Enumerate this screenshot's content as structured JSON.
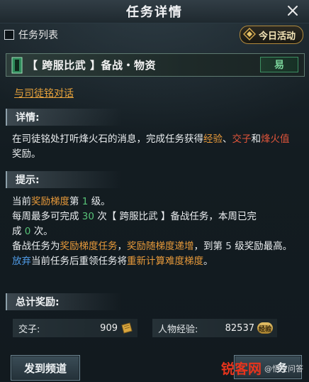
{
  "title": "任务详情",
  "task_list_label": "任务列表",
  "daily_button": "今日活动",
  "task": {
    "name": "【 跨服比武 】备战・物资",
    "difficulty": "易"
  },
  "npc_link": "与司徒铭对话",
  "details": {
    "heading": "详情:",
    "t1": "在司徒铭处打听烽火石的消息，完成任务获得",
    "t2": "经验",
    "t3": "、",
    "t4": "交子",
    "t5": "和",
    "t6": "烽火值",
    "t7": "奖励。"
  },
  "hints": {
    "heading": "提示:",
    "l1a": "当前",
    "l1b": "奖励梯度",
    "l1c": "第",
    "l1d": "1",
    "l1e": "级。",
    "l2a": "每周最多可完成",
    "l2b": "30",
    "l2c": "次【 跨服比武 】备战任务，本周已完成",
    "l2d": "0",
    "l2e": "次。",
    "l3a": "备战任务为",
    "l3b": "奖励梯度任务",
    "l3c": "，",
    "l3d": "奖励随梯度递增",
    "l3e": "，到第",
    "l3f": "5",
    "l3g": "级奖励最高。",
    "l3h": "放弃",
    "l3i": "当前任务后重领任务将",
    "l3j": "重新计算难度梯度",
    "l3k": "。"
  },
  "rewards": {
    "heading": "总计奖励:",
    "items": [
      {
        "label": "交子:",
        "value": "909",
        "icon": "banknote-icon"
      },
      {
        "label": "人物经验:",
        "value": "82537",
        "icon": "exp-badge-icon",
        "badge": "经验"
      }
    ]
  },
  "buttons": {
    "send_channel": "发到频道",
    "right_partial": "务"
  },
  "watermark": {
    "logo": "锐客网",
    "text": "@悟空问答"
  },
  "colors": {
    "orange": "#e89a3a",
    "red": "#e2553b",
    "green": "#57c277",
    "blue": "#4f9be6",
    "difficulty_green": "#7ad39a"
  }
}
